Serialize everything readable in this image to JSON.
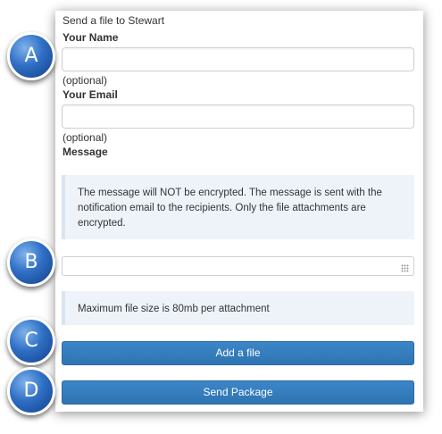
{
  "form": {
    "title": "Send a file to Stewart",
    "name_label": "Your Name",
    "name_hint": "(optional)",
    "email_label": "Your Email",
    "email_hint": "(optional)",
    "message_label": "Message",
    "encryption_notice": [
      "The message will NOT be encrypted. The message is sent with the",
      "notification email to the recipients. Only the file attachments are",
      "encrypted."
    ],
    "size_notice": "Maximum file size is 80mb per attachment",
    "add_file_label": "Add a file",
    "send_label": "Send Package"
  },
  "markers": [
    "A",
    "B",
    "C",
    "D"
  ]
}
